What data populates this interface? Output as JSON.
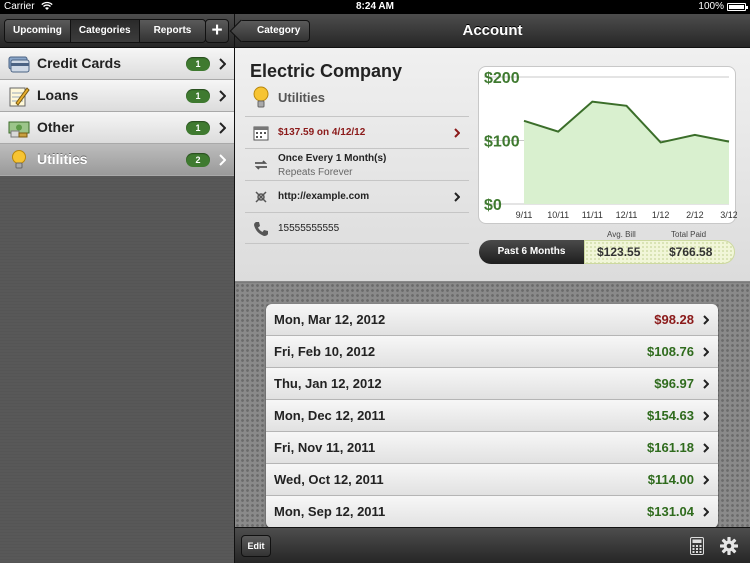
{
  "status": {
    "carrier": "Carrier",
    "time": "8:24 AM",
    "battery": "100%"
  },
  "left": {
    "tabs": [
      {
        "label": "Upcoming"
      },
      {
        "label": "Categories"
      },
      {
        "label": "Reports"
      }
    ],
    "add_label": "+",
    "categories": [
      {
        "label": "Credit Cards",
        "count": "1",
        "icon": "credit-card-icon"
      },
      {
        "label": "Loans",
        "count": "1",
        "icon": "notepad-pencil-icon"
      },
      {
        "label": "Other",
        "count": "1",
        "icon": "money-icon"
      },
      {
        "label": "Utilities",
        "count": "2",
        "icon": "lightbulb-icon"
      }
    ]
  },
  "nav": {
    "back_label": "Category",
    "title": "Account"
  },
  "account": {
    "name": "Electric Company",
    "category": "Utilities",
    "next_bill": "$137.59 on 4/12/12",
    "recurrence": "Once Every 1 Month(s)",
    "repeats": "Repeats Forever",
    "website": "http://example.com",
    "phone": "15555555555"
  },
  "chart_data": {
    "type": "area",
    "x": [
      "9/11",
      "10/11",
      "11/11",
      "12/11",
      "1/12",
      "2/12",
      "3/12"
    ],
    "values": [
      131.04,
      114.0,
      161.18,
      154.63,
      96.97,
      108.76,
      98.28
    ],
    "yticks": [
      "$200",
      "$100",
      "$0"
    ],
    "ylim": [
      0,
      200
    ],
    "grid": true,
    "fill_color": "#d9f0cf",
    "line_color": "#3b6e2a"
  },
  "period": {
    "label": "Past 6 Months",
    "avg_label": "Avg. Bill",
    "avg": "$123.55",
    "total_label": "Total Paid",
    "total": "$766.58"
  },
  "history": [
    {
      "date": "Mon, Mar 12, 2012",
      "amount": "$98.28",
      "late": true
    },
    {
      "date": "Fri, Feb 10, 2012",
      "amount": "$108.76",
      "late": false
    },
    {
      "date": "Thu, Jan 12, 2012",
      "amount": "$96.97",
      "late": false
    },
    {
      "date": "Mon, Dec 12, 2011",
      "amount": "$154.63",
      "late": false
    },
    {
      "date": "Fri, Nov 11, 2011",
      "amount": "$161.18",
      "late": false
    },
    {
      "date": "Wed, Oct 12, 2011",
      "amount": "$114.00",
      "late": false
    },
    {
      "date": "Mon, Sep 12, 2011",
      "amount": "$131.04",
      "late": false
    }
  ],
  "toolbar": {
    "edit_label": "Edit"
  },
  "colors": {
    "paid_amount": "#2f6b1d",
    "late_amount": "#8b1a1a",
    "badge": "#3f7a30"
  }
}
